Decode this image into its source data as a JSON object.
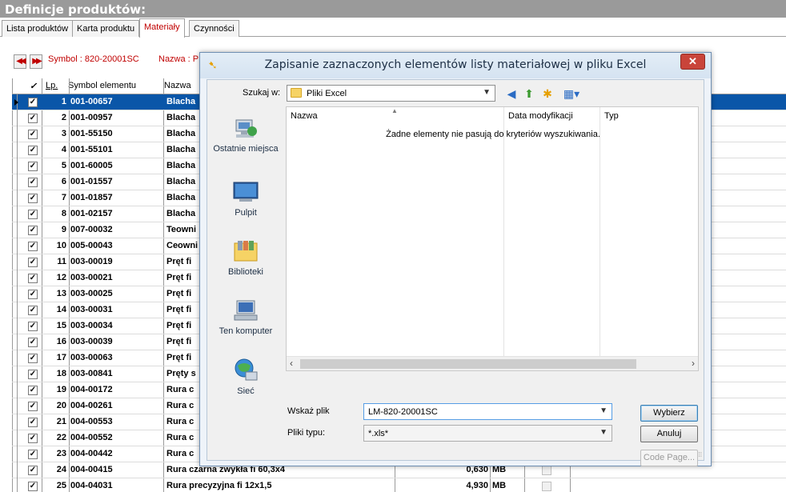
{
  "app": {
    "title": "Definicje produktów:"
  },
  "tabs": [
    {
      "label": "Lista produktów"
    },
    {
      "label": "Karta produktu"
    },
    {
      "label": "Materiały"
    },
    {
      "label": "Czynności"
    }
  ],
  "info": {
    "symbol": "Symbol : 820-20001SC",
    "name": "Nazwa : P"
  },
  "grid": {
    "headers": {
      "check": "✓",
      "lp": "Lp.",
      "symbol": "Symbol elementu",
      "name": "Nazwa"
    },
    "rows": [
      {
        "lp": "1",
        "symbol": "001-00657",
        "name": "Blacha",
        "qty": "",
        "unit": "",
        "selected": true
      },
      {
        "lp": "2",
        "symbol": "001-00957",
        "name": "Blacha",
        "qty": "",
        "unit": ""
      },
      {
        "lp": "3",
        "symbol": "001-55150",
        "name": "Blacha",
        "qty": "",
        "unit": ""
      },
      {
        "lp": "4",
        "symbol": "001-55101",
        "name": "Blacha",
        "qty": "",
        "unit": ""
      },
      {
        "lp": "5",
        "symbol": "001-60005",
        "name": "Blacha",
        "qty": "",
        "unit": ""
      },
      {
        "lp": "6",
        "symbol": "001-01557",
        "name": "Blacha",
        "qty": "",
        "unit": ""
      },
      {
        "lp": "7",
        "symbol": "001-01857",
        "name": "Blacha",
        "qty": "",
        "unit": ""
      },
      {
        "lp": "8",
        "symbol": "001-02157",
        "name": "Blacha",
        "qty": "",
        "unit": ""
      },
      {
        "lp": "9",
        "symbol": "007-00032",
        "name": "Teowni",
        "qty": "",
        "unit": ""
      },
      {
        "lp": "10",
        "symbol": "005-00043",
        "name": "Ceowni",
        "qty": "",
        "unit": ""
      },
      {
        "lp": "11",
        "symbol": "003-00019",
        "name": "Pręt fi",
        "qty": "",
        "unit": ""
      },
      {
        "lp": "12",
        "symbol": "003-00021",
        "name": "Pręt fi",
        "qty": "",
        "unit": ""
      },
      {
        "lp": "13",
        "symbol": "003-00025",
        "name": "Pręt fi",
        "qty": "",
        "unit": ""
      },
      {
        "lp": "14",
        "symbol": "003-00031",
        "name": "Pręt fi",
        "qty": "",
        "unit": ""
      },
      {
        "lp": "15",
        "symbol": "003-00034",
        "name": "Pręt fi",
        "qty": "",
        "unit": ""
      },
      {
        "lp": "16",
        "symbol": "003-00039",
        "name": "Pręt fi",
        "qty": "",
        "unit": ""
      },
      {
        "lp": "17",
        "symbol": "003-00063",
        "name": "Pręt fi",
        "qty": "",
        "unit": ""
      },
      {
        "lp": "18",
        "symbol": "003-00841",
        "name": "Pręty s",
        "qty": "",
        "unit": ""
      },
      {
        "lp": "19",
        "symbol": "004-00172",
        "name": "Rura c",
        "qty": "",
        "unit": ""
      },
      {
        "lp": "20",
        "symbol": "004-00261",
        "name": "Rura c",
        "qty": "",
        "unit": ""
      },
      {
        "lp": "21",
        "symbol": "004-00553",
        "name": "Rura c",
        "qty": "",
        "unit": ""
      },
      {
        "lp": "22",
        "symbol": "004-00552",
        "name": "Rura c",
        "qty": "",
        "unit": ""
      },
      {
        "lp": "23",
        "symbol": "004-00442",
        "name": "Rura c",
        "qty": "",
        "unit": ""
      },
      {
        "lp": "24",
        "symbol": "004-00415",
        "name": "Rura czarna zwykła fi 60,3x4",
        "qty": "0,630",
        "unit": "MB"
      },
      {
        "lp": "25",
        "symbol": "004-04031",
        "name": "Rura precyzyjna fi 12x1,5",
        "qty": "4,930",
        "unit": "MB"
      }
    ]
  },
  "dialog": {
    "title": "Zapisanie zaznaczonych elementów listy materiałowej w pliku Excel",
    "look_in_label": "Szukaj w:",
    "look_in_value": "Pliki Excel",
    "places": [
      {
        "label": "Ostatnie miejsca"
      },
      {
        "label": "Pulpit"
      },
      {
        "label": "Biblioteki"
      },
      {
        "label": "Ten komputer"
      },
      {
        "label": "Sieć"
      }
    ],
    "columns": {
      "name": "Nazwa",
      "date": "Data modyfikacji",
      "type": "Typ"
    },
    "empty_message": "Żadne elementy nie pasują do kryteriów wyszukiwania.",
    "filename_label": "Wskaż plik",
    "filename_value": "LM-820-20001SC",
    "filetype_label": "Pliki typu:",
    "filetype_value": "*.xls*",
    "buttons": {
      "select": "Wybierz",
      "cancel": "Anuluj",
      "codepage": "Code Page..."
    }
  }
}
